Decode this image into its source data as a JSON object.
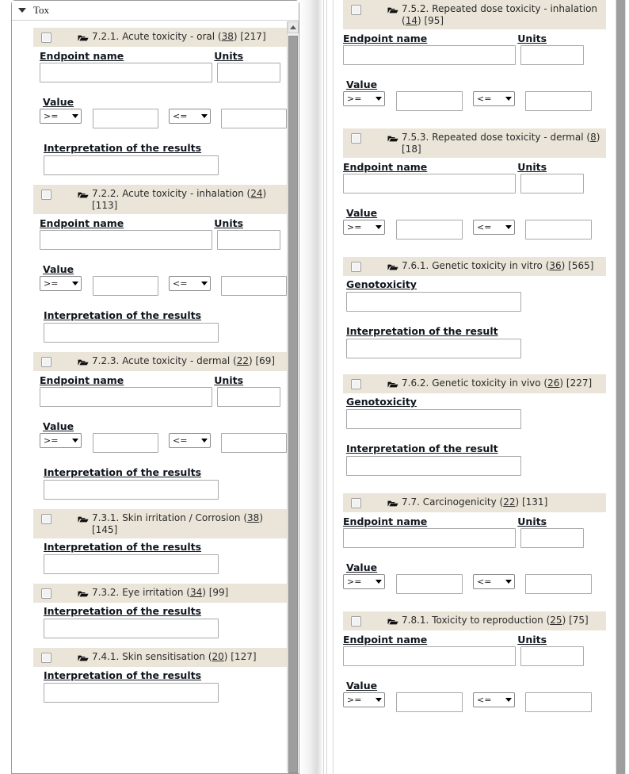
{
  "window": {
    "tox_panel_title": "Tox",
    "caret_icon": "chevron-down-icon",
    "folder_icon": "folder-open-icon",
    "checkbox_icon": "checkbox-unchecked-icon",
    "scrollbar_up_icon": "scroll-up-arrow-icon"
  },
  "labels": {
    "endpoint_name": "Endpoint name",
    "units": "Units",
    "value": "Value",
    "interpretation_results": "Interpretation of the results",
    "interpretation_result": "Interpretation of the result",
    "genotoxicity": "Genotoxicity"
  },
  "operators": {
    "gte": ">=",
    "lte": "<="
  },
  "colors": {
    "section_header_bg": "#eae5d8",
    "panel_bg": "#ffffff",
    "border": "#a9a9a9",
    "text": "#2b2b2b",
    "scroll_thumb": "#9e9e9e"
  },
  "left_panel": {
    "sections": [
      {
        "number": "7.2.1.",
        "name": "Acute toxicity - oral",
        "link_count": "38",
        "bracket_count": "[217]",
        "fields": [
          "endpoint_units",
          "value",
          "interpretation_results"
        ]
      },
      {
        "number": "7.2.2.",
        "name": "Acute toxicity - inhalation",
        "link_count": "24",
        "bracket_count": "[113]",
        "fields": [
          "endpoint_units",
          "value",
          "interpretation_results"
        ]
      },
      {
        "number": "7.2.3.",
        "name": "Acute toxicity - dermal",
        "link_count": "22",
        "bracket_count": "[69]",
        "fields": [
          "endpoint_units",
          "value",
          "interpretation_results"
        ]
      },
      {
        "number": "7.3.1.",
        "name": "Skin irritation / Corrosion",
        "link_count": "38",
        "bracket_count": "[145]",
        "fields": [
          "interpretation_results"
        ]
      },
      {
        "number": "7.3.2.",
        "name": "Eye irritation",
        "link_count": "34",
        "bracket_count": "[99]",
        "fields": [
          "interpretation_results"
        ]
      },
      {
        "number": "7.4.1.",
        "name": "Skin sensitisation",
        "link_count": "20",
        "bracket_count": "[127]",
        "fields": [
          "interpretation_results"
        ]
      }
    ]
  },
  "right_panel": {
    "sections": [
      {
        "number": "7.5.2.",
        "name": "Repeated dose toxicity - inhalation",
        "link_count": "14",
        "bracket_count": "[95]",
        "fields": [
          "endpoint_units",
          "value"
        ]
      },
      {
        "number": "7.5.3.",
        "name": "Repeated dose toxicity - dermal",
        "link_count": "8",
        "bracket_count": "[18]",
        "fields": [
          "endpoint_units",
          "value"
        ]
      },
      {
        "number": "7.6.1.",
        "name": "Genetic toxicity in vitro",
        "link_count": "36",
        "bracket_count": "[565]",
        "fields": [
          "genotoxicity",
          "interpretation_result"
        ]
      },
      {
        "number": "7.6.2.",
        "name": "Genetic toxicity in vivo",
        "link_count": "26",
        "bracket_count": "[227]",
        "fields": [
          "genotoxicity",
          "interpretation_result"
        ]
      },
      {
        "number": "7.7.",
        "name": "Carcinogenicity",
        "link_count": "22",
        "bracket_count": "[131]",
        "fields": [
          "endpoint_units",
          "value"
        ]
      },
      {
        "number": "7.8.1.",
        "name": "Toxicity to reproduction",
        "link_count": "25",
        "bracket_count": "[75]",
        "fields": [
          "endpoint_units",
          "value"
        ]
      }
    ]
  }
}
